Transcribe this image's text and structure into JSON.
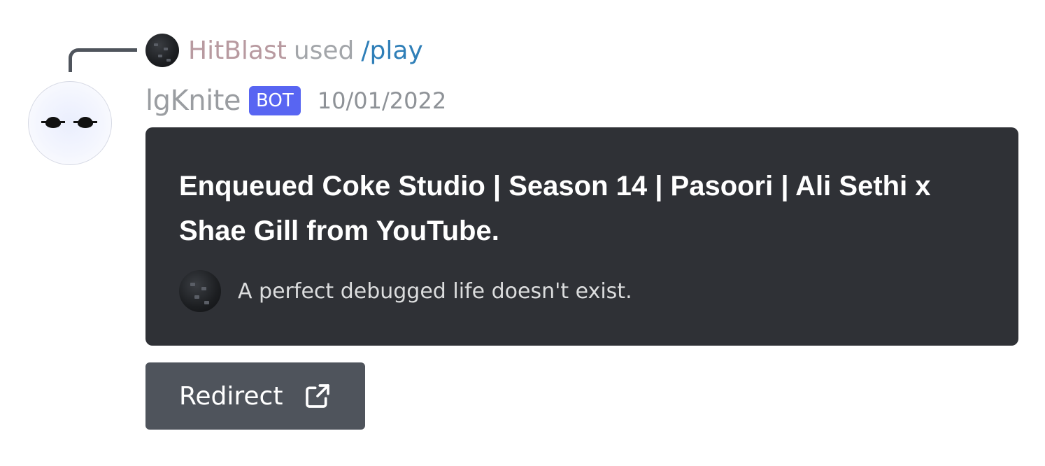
{
  "reply": {
    "username": "HitBlast",
    "used_text": "used",
    "command": "/play"
  },
  "message": {
    "author": "lgKnite",
    "bot_tag": "BOT",
    "timestamp": "10/01/2022"
  },
  "embed": {
    "title": "Enqueued Coke Studio | Season 14 | Pasoori | Ali Sethi x Shae Gill from YouTube.",
    "footer_text": "A perfect debugged life doesn't exist.",
    "background_color": "#2f3136"
  },
  "button": {
    "label": "Redirect",
    "icon": "external-link-icon",
    "color": "#4f545c"
  },
  "colors": {
    "bot_tag": "#5865f2",
    "command_link": "#2f7fb8",
    "reply_username": "#b89aa0"
  }
}
